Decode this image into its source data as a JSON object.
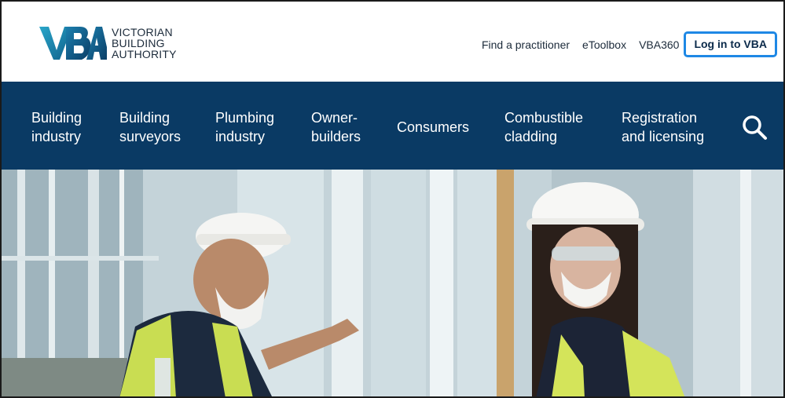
{
  "header": {
    "logo": {
      "mark": "VBA",
      "line1": "VICTORIAN",
      "line2": "BUILDING",
      "line3": "AUTHORITY"
    },
    "util_links": [
      {
        "label": "Find a practitioner"
      },
      {
        "label": "eToolbox"
      },
      {
        "label": "VBA360"
      }
    ],
    "login_label": "Log in to VBA"
  },
  "nav": {
    "items": [
      {
        "line1": "Building",
        "line2": "industry"
      },
      {
        "line1": "Building",
        "line2": "surveyors"
      },
      {
        "line1": "Plumbing",
        "line2": "industry"
      },
      {
        "line1": "Owner-",
        "line2": "builders"
      },
      {
        "line1": "Consumers",
        "line2": ""
      },
      {
        "line1": "Combustible",
        "line2": "cladding"
      },
      {
        "line1": "Registration",
        "line2": "and licensing"
      }
    ],
    "search_icon": "search-icon"
  },
  "colors": {
    "nav_bg": "#0a3a64",
    "accent_blue": "#1e88e5",
    "logo_teal": "#1b8fb0",
    "logo_dark": "#0b2a4a"
  }
}
